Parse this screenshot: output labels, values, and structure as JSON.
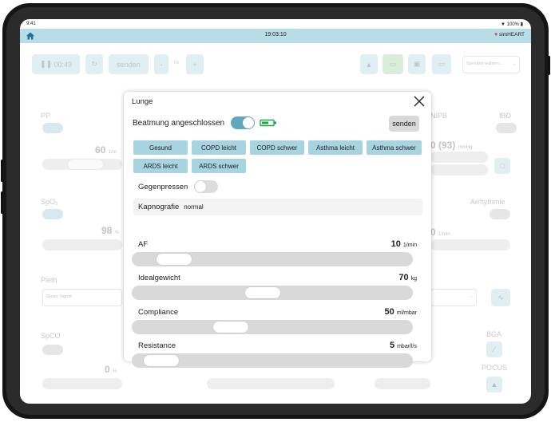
{
  "status_bar": {
    "time": "9:41",
    "battery": "100%"
  },
  "top_bar": {
    "clock": "19:03:10",
    "brand": "simHEART"
  },
  "background": {
    "timer": "00:49",
    "send_label": "senden",
    "minus": "-",
    "zero": "0s",
    "plus": "+",
    "scenario_placeholder": "Szenario wählen...",
    "pp_label": "PP",
    "pp_value": "60",
    "pp_unit": "1/m",
    "nipb_label": "NIPB",
    "nipb_value": "0 (93)",
    "nipb_unit": "mmHg",
    "ibd_label": "IBD",
    "spo2_label": "SpO₂",
    "spo2_value": "98",
    "spo2_unit": "%",
    "arrhythmia_label": "Arrhythmie",
    "af_bg_value": "0",
    "af_bg_unit": "1/min",
    "pleth_label": "Pleth",
    "pleth_select": "Gutes Signal",
    "spco_label": "SpCO",
    "spco_value": "0",
    "spco_unit": "%",
    "bga_label": "BGA",
    "pocus_label": "POCUS"
  },
  "modal": {
    "title": "Lunge",
    "ventilation_label": "Beatmung angeschlossen",
    "ventilation_on": true,
    "send_label": "senden",
    "presets": [
      "Gesund",
      "COPD leicht",
      "COPD schwer",
      "Asthma leicht",
      "Asthma schwer",
      "ARDS leicht",
      "ARDS schwer"
    ],
    "gegenpressen_label": "Gegenpressen",
    "gegenpressen_on": false,
    "kapnografie_label": "Kapnografie",
    "kapnografie_value": "normal",
    "params": [
      {
        "label": "AF",
        "value": "10",
        "unit": "1/min",
        "slider_fraction": 0.1
      },
      {
        "label": "Idealgewicht",
        "value": "70",
        "unit": "kg",
        "slider_fraction": 0.46
      },
      {
        "label": "Compliance",
        "value": "50",
        "unit": "ml/mbar",
        "slider_fraction": 0.33
      },
      {
        "label": "Resistance",
        "value": "5",
        "unit": "mbar/l/s",
        "slider_fraction": 0.05
      }
    ]
  },
  "colors": {
    "accent": "#5fa8bd",
    "preset": "#a7d4e0",
    "topbar": "#b8dde6",
    "battery": "#1fa84a"
  }
}
